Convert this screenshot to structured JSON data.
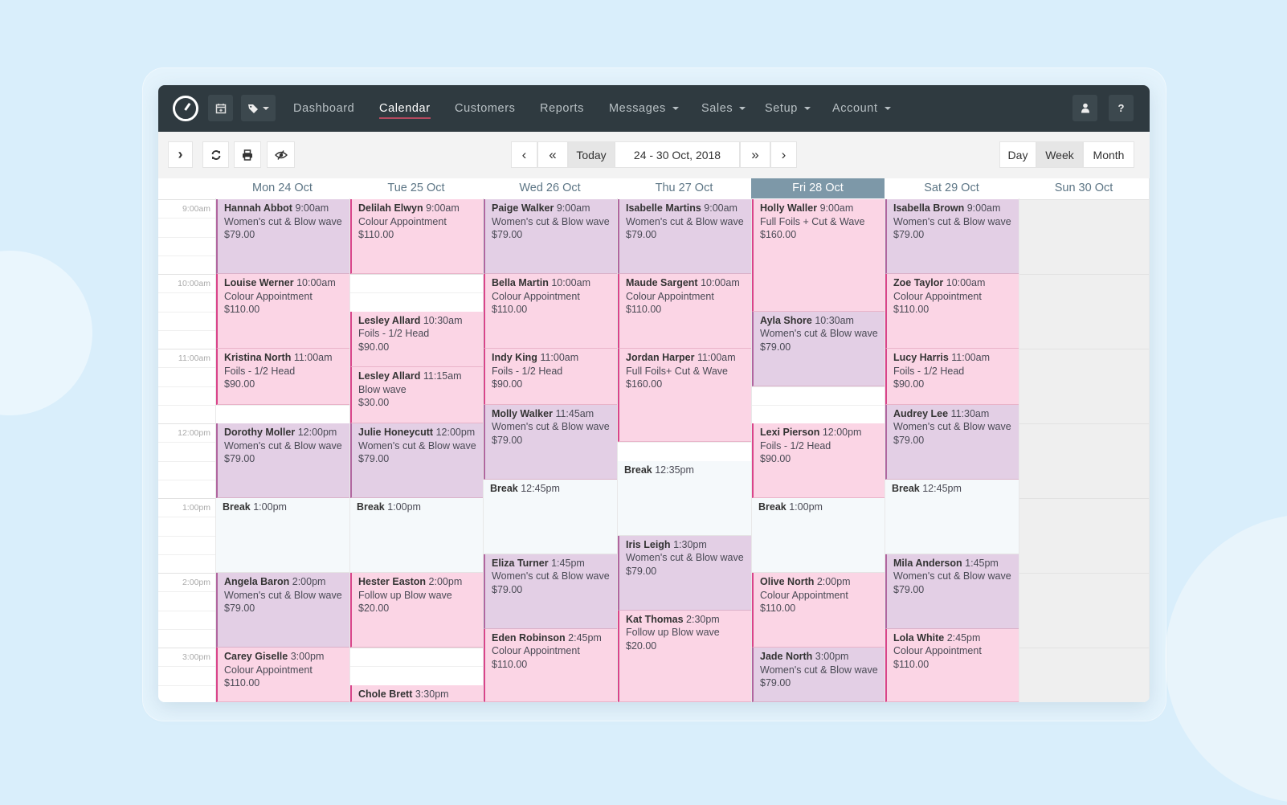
{
  "nav": {
    "items": [
      {
        "label": "Dashboard",
        "active": false,
        "dropdown": false
      },
      {
        "label": "Calendar",
        "active": true,
        "dropdown": false
      },
      {
        "label": "Customers",
        "active": false,
        "dropdown": false
      },
      {
        "label": "Reports",
        "active": false,
        "dropdown": false
      },
      {
        "label": "Messages",
        "active": false,
        "dropdown": true
      },
      {
        "label": "Sales",
        "active": false,
        "dropdown": true
      },
      {
        "label": "Setup",
        "active": false,
        "dropdown": true
      },
      {
        "label": "Account",
        "active": false,
        "dropdown": true
      }
    ],
    "icons": {
      "logo": "clock-logo-icon",
      "calendar": "calendar-add-icon",
      "tag": "tag-icon",
      "user": "user-icon",
      "help": "?"
    }
  },
  "toolbar": {
    "expand": "›",
    "refresh": "⟳",
    "print": "🖶",
    "visibility": "⊘",
    "prev": "‹",
    "prev_fast": "«",
    "today": "Today",
    "range": "24 - 30 Oct, 2018",
    "next_fast": "»",
    "next": "›",
    "views": [
      "Day",
      "Week",
      "Month"
    ],
    "active_view": "Week"
  },
  "calendar": {
    "days": [
      {
        "label": "Mon 24 Oct",
        "today": false
      },
      {
        "label": "Tue 25 Oct",
        "today": false
      },
      {
        "label": "Wed 26 Oct",
        "today": false
      },
      {
        "label": "Thu 27 Oct",
        "today": false
      },
      {
        "label": "Fri 28 Oct",
        "today": true
      },
      {
        "label": "Sat 29 Oct",
        "today": false
      },
      {
        "label": "Sun 30 Oct",
        "today": false
      }
    ],
    "times": [
      "9:00am",
      "10:00am",
      "11:00am",
      "12:00pm",
      "1:00pm",
      "2:00pm",
      "3:00pm"
    ],
    "appointments": [
      {
        "day": 0,
        "start": 9.0,
        "end": 10.0,
        "name": "Hannah Abbot",
        "time": "9:00am",
        "service": "Women's cut & Blow wave",
        "price": "$79.00",
        "type": "purple"
      },
      {
        "day": 0,
        "start": 10.0,
        "end": 11.0,
        "name": "Louise Werner",
        "time": "10:00am",
        "service": "Colour Appointment",
        "price": "$110.00",
        "type": "pink"
      },
      {
        "day": 0,
        "start": 11.0,
        "end": 11.75,
        "name": "Kristina North",
        "time": "11:00am",
        "service": "Foils - 1/2 Head",
        "price": "$90.00",
        "type": "pink"
      },
      {
        "day": 0,
        "start": 12.0,
        "end": 13.0,
        "name": "Dorothy Moller",
        "time": "12:00pm",
        "service": "Women's cut & Blow wave",
        "price": "$79.00",
        "type": "purple"
      },
      {
        "day": 0,
        "start": 13.0,
        "end": 14.0,
        "name": "Break",
        "time": "1:00pm",
        "service": "",
        "price": "",
        "type": "brk"
      },
      {
        "day": 0,
        "start": 14.0,
        "end": 15.0,
        "name": "Angela Baron",
        "time": "2:00pm",
        "service": "Women's cut & Blow wave",
        "price": "$79.00",
        "type": "purple"
      },
      {
        "day": 0,
        "start": 15.0,
        "end": 15.75,
        "name": "Carey Giselle",
        "time": "3:00pm",
        "service": "Colour Appointment",
        "price": "$110.00",
        "type": "pink"
      },
      {
        "day": 1,
        "start": 9.0,
        "end": 10.0,
        "name": "Delilah Elwyn",
        "time": "9:00am",
        "service": "Colour Appointment",
        "price": "$110.00",
        "type": "pink"
      },
      {
        "day": 1,
        "start": 10.5,
        "end": 11.25,
        "name": "Lesley Allard",
        "time": "10:30am",
        "service": "Foils - 1/2 Head",
        "price": "$90.00",
        "type": "pink"
      },
      {
        "day": 1,
        "start": 11.25,
        "end": 12.0,
        "name": "Lesley Allard",
        "time": "11:15am",
        "service": "Blow wave",
        "price": "$30.00",
        "type": "pink"
      },
      {
        "day": 1,
        "start": 12.0,
        "end": 13.0,
        "name": "Julie Honeycutt",
        "time": "12:00pm",
        "service": "Women's cut & Blow wave",
        "price": "$79.00",
        "type": "purple"
      },
      {
        "day": 1,
        "start": 13.0,
        "end": 14.0,
        "name": "Break",
        "time": "1:00pm",
        "service": "",
        "price": "",
        "type": "brk"
      },
      {
        "day": 1,
        "start": 14.0,
        "end": 15.0,
        "name": "Hester Easton",
        "time": "2:00pm",
        "service": "Follow up Blow wave",
        "price": "$20.00",
        "type": "pink"
      },
      {
        "day": 1,
        "start": 15.5,
        "end": 15.75,
        "name": "Chole Brett",
        "time": "3:30pm",
        "service": "",
        "price": "",
        "type": "pink"
      },
      {
        "day": 2,
        "start": 9.0,
        "end": 10.0,
        "name": "Paige Walker",
        "time": "9:00am",
        "service": "Women's cut & Blow wave",
        "price": "$79.00",
        "type": "purple"
      },
      {
        "day": 2,
        "start": 10.0,
        "end": 11.0,
        "name": "Bella Martin",
        "time": "10:00am",
        "service": "Colour Appointment",
        "price": "$110.00",
        "type": "pink"
      },
      {
        "day": 2,
        "start": 11.0,
        "end": 11.75,
        "name": "Indy King",
        "time": "11:00am",
        "service": "Foils - 1/2 Head",
        "price": "$90.00",
        "type": "pink"
      },
      {
        "day": 2,
        "start": 11.75,
        "end": 12.75,
        "name": "Molly Walker",
        "time": "11:45am",
        "service": "Women's cut & Blow wave",
        "price": "$79.00",
        "type": "purple"
      },
      {
        "day": 2,
        "start": 12.75,
        "end": 13.75,
        "name": "Break",
        "time": "12:45pm",
        "service": "",
        "price": "",
        "type": "brk"
      },
      {
        "day": 2,
        "start": 13.75,
        "end": 14.75,
        "name": "Eliza Turner",
        "time": "1:45pm",
        "service": "Women's cut & Blow wave",
        "price": "$79.00",
        "type": "purple"
      },
      {
        "day": 2,
        "start": 14.75,
        "end": 15.75,
        "name": "Eden Robinson",
        "time": "2:45pm",
        "service": "Colour Appointment",
        "price": "$110.00",
        "type": "pink"
      },
      {
        "day": 3,
        "start": 9.0,
        "end": 10.0,
        "name": "Isabelle Martins",
        "time": "9:00am",
        "service": "Women's cut & Blow wave",
        "price": "$79.00",
        "type": "purple"
      },
      {
        "day": 3,
        "start": 10.0,
        "end": 11.0,
        "name": "Maude Sargent",
        "time": "10:00am",
        "service": "Colour Appointment",
        "price": "$110.00",
        "type": "pink"
      },
      {
        "day": 3,
        "start": 11.0,
        "end": 12.25,
        "name": "Jordan Harper",
        "time": "11:00am",
        "service": "Full Foils+ Cut & Wave",
        "price": "$160.00",
        "type": "pink"
      },
      {
        "day": 3,
        "start": 12.5,
        "end": 13.5,
        "name": "Break",
        "time": "12:35pm",
        "service": "",
        "price": "",
        "type": "brk"
      },
      {
        "day": 3,
        "start": 13.5,
        "end": 14.5,
        "name": "Iris Leigh",
        "time": "1:30pm",
        "service": "Women's cut & Blow wave",
        "price": "$79.00",
        "type": "purple"
      },
      {
        "day": 3,
        "start": 14.5,
        "end": 15.75,
        "name": "Kat Thomas",
        "time": "2:30pm",
        "service": "Follow up Blow wave",
        "price": "$20.00",
        "type": "pink"
      },
      {
        "day": 4,
        "start": 9.0,
        "end": 10.5,
        "name": "Holly Waller",
        "time": "9:00am",
        "service": "Full Foils + Cut & Wave",
        "price": "$160.00",
        "type": "pink"
      },
      {
        "day": 4,
        "start": 10.5,
        "end": 11.5,
        "name": "Ayla Shore",
        "time": "10:30am",
        "service": "Women's cut & Blow wave",
        "price": "$79.00",
        "type": "purple"
      },
      {
        "day": 4,
        "start": 12.0,
        "end": 13.0,
        "name": "Lexi Pierson",
        "time": "12:00pm",
        "service": "Foils - 1/2 Head",
        "price": "$90.00",
        "type": "pink"
      },
      {
        "day": 4,
        "start": 13.0,
        "end": 14.0,
        "name": "Break",
        "time": "1:00pm",
        "service": "",
        "price": "",
        "type": "brk"
      },
      {
        "day": 4,
        "start": 14.0,
        "end": 15.0,
        "name": "Olive North",
        "time": "2:00pm",
        "service": "Colour Appointment",
        "price": "$110.00",
        "type": "pink"
      },
      {
        "day": 4,
        "start": 15.0,
        "end": 15.75,
        "name": "Jade North",
        "time": "3:00pm",
        "service": "Women's cut & Blow wave",
        "price": "$79.00",
        "type": "purple"
      },
      {
        "day": 5,
        "start": 9.0,
        "end": 10.0,
        "name": "Isabella Brown",
        "time": "9:00am",
        "service": "Women's cut & Blow wave",
        "price": "$79.00",
        "type": "purple"
      },
      {
        "day": 5,
        "start": 10.0,
        "end": 11.0,
        "name": "Zoe Taylor",
        "time": "10:00am",
        "service": "Colour Appointment",
        "price": "$110.00",
        "type": "pink"
      },
      {
        "day": 5,
        "start": 11.0,
        "end": 11.75,
        "name": "Lucy Harris",
        "time": "11:00am",
        "service": "Foils - 1/2 Head",
        "price": "$90.00",
        "type": "pink"
      },
      {
        "day": 5,
        "start": 11.75,
        "end": 12.75,
        "name": "Audrey Lee",
        "time": "11:30am",
        "service": "Women's cut & Blow wave",
        "price": "$79.00",
        "type": "purple"
      },
      {
        "day": 5,
        "start": 12.75,
        "end": 13.75,
        "name": "Break",
        "time": "12:45pm",
        "service": "",
        "price": "",
        "type": "brk"
      },
      {
        "day": 5,
        "start": 13.75,
        "end": 14.75,
        "name": "Mila Anderson",
        "time": "1:45pm",
        "service": "Women's cut & Blow wave",
        "price": "$79.00",
        "type": "purple"
      },
      {
        "day": 5,
        "start": 14.75,
        "end": 15.75,
        "name": "Lola White",
        "time": "2:45pm",
        "service": "Colour Appointment",
        "price": "$110.00",
        "type": "pink"
      }
    ]
  }
}
